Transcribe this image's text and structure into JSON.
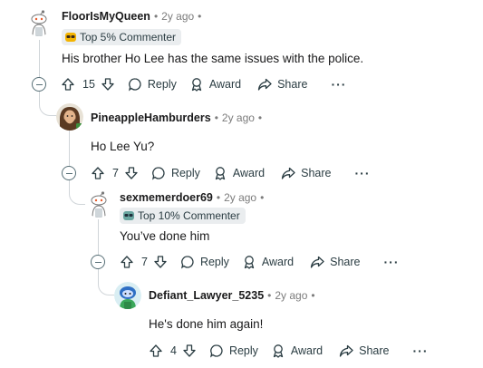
{
  "comments": [
    {
      "username": "FloorIsMyQueen",
      "time": "2y ago",
      "dot": "•",
      "badge": "Top 5% Commenter",
      "text": "His brother Ho Lee has the same issues with the police.",
      "votes": "15",
      "reply_label": "Reply",
      "award_label": "Award",
      "share_label": "Share",
      "more_label": "···"
    },
    {
      "username": "PineappleHamburders",
      "time": "2y ago",
      "dot": "•",
      "text": "Ho Lee Yu?",
      "votes": "7",
      "reply_label": "Reply",
      "award_label": "Award",
      "share_label": "Share",
      "more_label": "···"
    },
    {
      "username": "sexmemerdoer69",
      "time": "2y ago",
      "dot": "•",
      "badge": "Top 10% Commenter",
      "text": "You’ve done him",
      "votes": "7",
      "reply_label": "Reply",
      "award_label": "Award",
      "share_label": "Share",
      "more_label": "···"
    },
    {
      "username": "Defiant_Lawyer_5235",
      "time": "2y ago",
      "dot": "•",
      "text": "He's done him again!",
      "votes": "4",
      "reply_label": "Reply",
      "award_label": "Award",
      "share_label": "Share",
      "more_label": "···"
    }
  ]
}
